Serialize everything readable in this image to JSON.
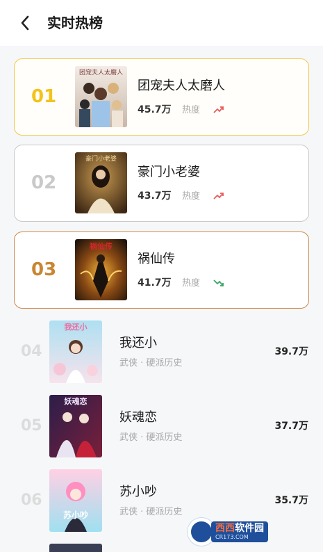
{
  "header": {
    "title": "实时热榜",
    "back_icon": "back-arrow-icon"
  },
  "heat_label": "热度",
  "top_books": [
    {
      "rank": "01",
      "name": "团宠夫人太磨人",
      "heat": "45.7万",
      "trend": "up",
      "rank_color": "#f2c31a",
      "cover_text": "团宠夫人太磨人"
    },
    {
      "rank": "02",
      "name": "豪门小老婆",
      "heat": "43.7万",
      "trend": "up",
      "rank_color": "#c9c9c9",
      "cover_text": "豪门小老婆"
    },
    {
      "rank": "03",
      "name": "祸仙传",
      "heat": "41.7万",
      "trend": "down",
      "rank_color": "#c98532",
      "cover_text": "祸仙传"
    }
  ],
  "other_books": [
    {
      "rank": "04",
      "name": "我还小",
      "tags": "武侠 · 硬派历史",
      "heat": "39.7万",
      "cover_text": "我还小"
    },
    {
      "rank": "05",
      "name": "妖魂恋",
      "tags": "武侠 · 硬派历史",
      "heat": "37.7万",
      "cover_text": "妖魂恋"
    },
    {
      "rank": "06",
      "name": "苏小吵",
      "tags": "武侠 · 硬派历史",
      "heat": "35.7万",
      "cover_text": "苏小吵"
    }
  ],
  "colors": {
    "trend_up": "#e85c5c",
    "trend_down": "#3aa564"
  },
  "watermark": {
    "brand_a": "西西",
    "brand_b": "软件园",
    "site": "CR173.COM"
  }
}
